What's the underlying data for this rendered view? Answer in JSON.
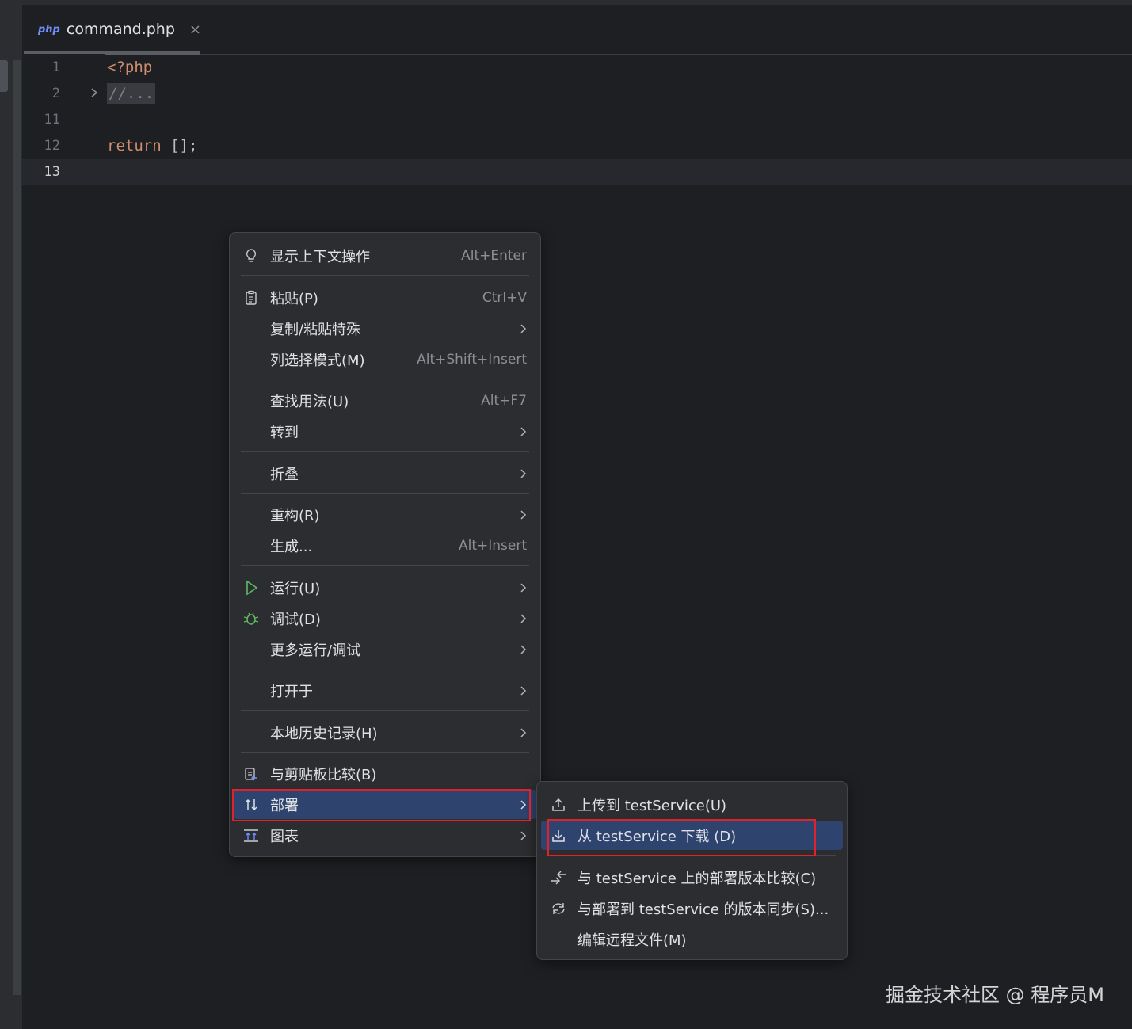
{
  "tab": {
    "file_type": "php",
    "file_name": "command.php",
    "close": "×"
  },
  "editor": {
    "lines": [
      {
        "num": "1",
        "code": "<?php"
      },
      {
        "num": "2",
        "code": "//..."
      },
      {
        "num": "11",
        "code": ""
      },
      {
        "num": "12",
        "code": "return",
        "code_rest": " [];"
      },
      {
        "num": "13",
        "code": ""
      }
    ]
  },
  "context_menu": {
    "items": [
      {
        "label": "显示上下文操作",
        "shortcut": "Alt+Enter",
        "icon": "lightbulb-icon"
      },
      {
        "label": "粘贴(P)",
        "shortcut": "Ctrl+V",
        "icon": "clipboard-icon"
      },
      {
        "label": "复制/粘贴特殊"
      },
      {
        "label": "列选择模式(M)",
        "shortcut": "Alt+Shift+Insert"
      },
      {
        "label": "查找用法(U)",
        "shortcut": "Alt+F7"
      },
      {
        "label": "转到"
      },
      {
        "label": "折叠"
      },
      {
        "label": "重构(R)"
      },
      {
        "label": "生成...",
        "shortcut": "Alt+Insert"
      },
      {
        "label": "运行(U)",
        "icon": "run-icon"
      },
      {
        "label": "调试(D)",
        "icon": "bug-icon"
      },
      {
        "label": "更多运行/调试"
      },
      {
        "label": "打开于"
      },
      {
        "label": "本地历史记录(H)"
      },
      {
        "label": "与剪贴板比较(B)",
        "icon": "compare-clipboard-icon"
      },
      {
        "label": "部署",
        "icon": "deploy-icon"
      },
      {
        "label": "图表",
        "icon": "diagram-icon"
      }
    ]
  },
  "submenu": {
    "items": [
      {
        "label": "上传到 testService(U)",
        "icon": "upload-icon"
      },
      {
        "label": "从 testService 下载 (D)",
        "icon": "download-icon"
      },
      {
        "label": "与 testService 上的部署版本比较(C)",
        "icon": "compare-icon"
      },
      {
        "label": "与部署到 testService 的版本同步(S)...",
        "icon": "sync-icon"
      },
      {
        "label": "编辑远程文件(M)"
      }
    ]
  },
  "watermark": "掘金技术社区 @ 程序员M",
  "colors": {
    "accent_selected": "#2e436e",
    "highlight_box": "#e0222a",
    "keyword": "#cf8e6d"
  }
}
